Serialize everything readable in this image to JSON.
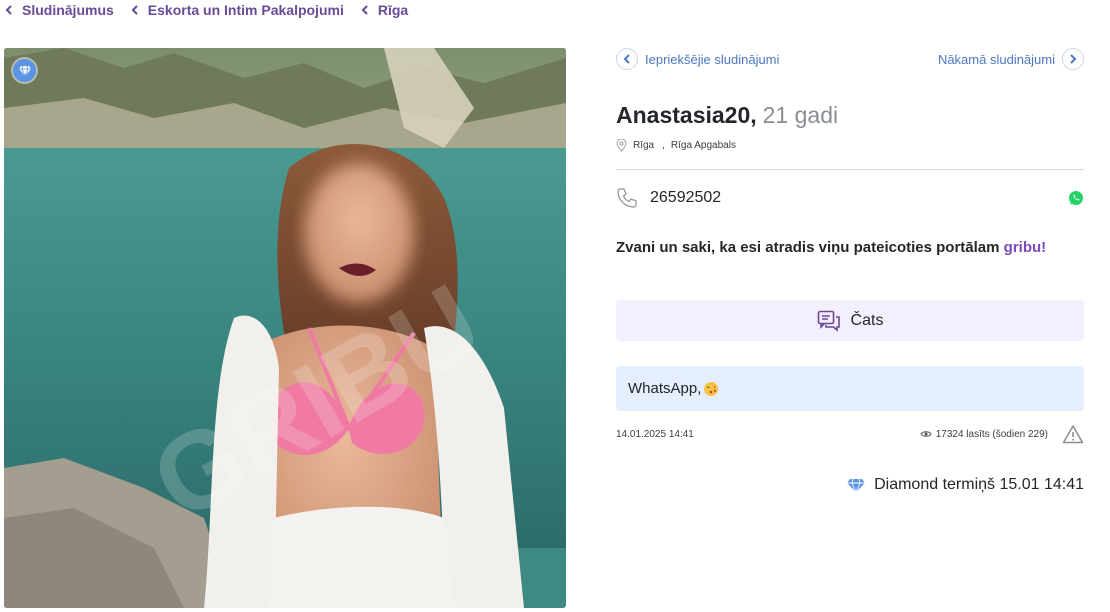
{
  "breadcrumb": [
    {
      "label": "Sludinājumus"
    },
    {
      "label": "Eskorta un Intim Pakalpojumi"
    },
    {
      "label": "Rīga"
    }
  ],
  "photo": {
    "watermark": "GRIBU",
    "badge_icon": "diamond-icon"
  },
  "nav": {
    "prev_label": "Iepriekšējie sludinājumi",
    "next_label": "Nākamā sludinājumi"
  },
  "listing": {
    "name": "Anastasia20,",
    "age": "21 gadi",
    "city": "Rīga",
    "region": "Rīga Apgabals",
    "phone": "26592502"
  },
  "call_prompt": {
    "text": "Zvani un saki, ka esi atradis viņu pateicoties portālam ",
    "brand": "gribu!"
  },
  "chat_button": {
    "label": "Čats"
  },
  "description": {
    "text": "WhatsApp,"
  },
  "meta": {
    "date": "14.01.2025 14:41",
    "views": "17324 lasīts (šodien 229)"
  },
  "diamond": {
    "text": "Diamond termiņš 15.01 14:41"
  },
  "colors": {
    "breadcrumb": "#6a4a97",
    "nav_link": "#4a78c2",
    "brand": "#7a4bb6",
    "whatsapp": "#25d366",
    "diamond": "#5b94e6"
  }
}
